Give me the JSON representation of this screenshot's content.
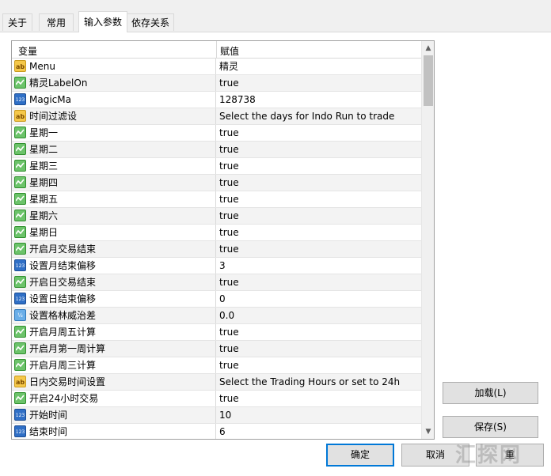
{
  "tabs": [
    {
      "label": "关于"
    },
    {
      "label": "常用"
    },
    {
      "label": "输入参数"
    },
    {
      "label": "依存关系"
    }
  ],
  "grid": {
    "header": {
      "variable": "变量",
      "value": "赋值"
    },
    "rows": [
      {
        "type": "ab",
        "name": "Menu",
        "value": "精灵"
      },
      {
        "type": "bool",
        "name": "精灵LabelOn",
        "value": "true"
      },
      {
        "type": "int",
        "name": "MagicMa",
        "value": "128738"
      },
      {
        "type": "ab",
        "name": "时间过滤设",
        "value": "Select the days for Indo Run to trade"
      },
      {
        "type": "bool",
        "name": "星期一",
        "value": "true"
      },
      {
        "type": "bool",
        "name": "星期二",
        "value": "true"
      },
      {
        "type": "bool",
        "name": "星期三",
        "value": "true"
      },
      {
        "type": "bool",
        "name": "星期四",
        "value": "true"
      },
      {
        "type": "bool",
        "name": "星期五",
        "value": "true"
      },
      {
        "type": "bool",
        "name": "星期六",
        "value": "true"
      },
      {
        "type": "bool",
        "name": "星期日",
        "value": "true"
      },
      {
        "type": "bool",
        "name": "开启月交易结束",
        "value": "true"
      },
      {
        "type": "int",
        "name": "设置月结束偏移",
        "value": "3"
      },
      {
        "type": "bool",
        "name": "开启日交易结束",
        "value": "true"
      },
      {
        "type": "int",
        "name": "设置日结束偏移",
        "value": "0"
      },
      {
        "type": "dbl",
        "name": "设置格林威治差",
        "value": "0.0"
      },
      {
        "type": "bool",
        "name": "开启月周五计算",
        "value": "true"
      },
      {
        "type": "bool",
        "name": "开启月第一周计算",
        "value": "true"
      },
      {
        "type": "bool",
        "name": "开启月周三计算",
        "value": "true"
      },
      {
        "type": "ab",
        "name": "日内交易时间设置",
        "value": "Select the Trading Hours or set to 24h"
      },
      {
        "type": "bool",
        "name": "开启24小时交易",
        "value": "true"
      },
      {
        "type": "int",
        "name": "开始时间",
        "value": "10"
      },
      {
        "type": "int",
        "name": "结束时间",
        "value": "6"
      }
    ]
  },
  "icons": {
    "ab": "ab",
    "int": "123",
    "dbl": "½"
  },
  "buttons": {
    "load": "加载(L)",
    "save": "保存(S)",
    "ok": "确定",
    "cancel": "取消",
    "reset": "重"
  },
  "watermark": "汇探网"
}
